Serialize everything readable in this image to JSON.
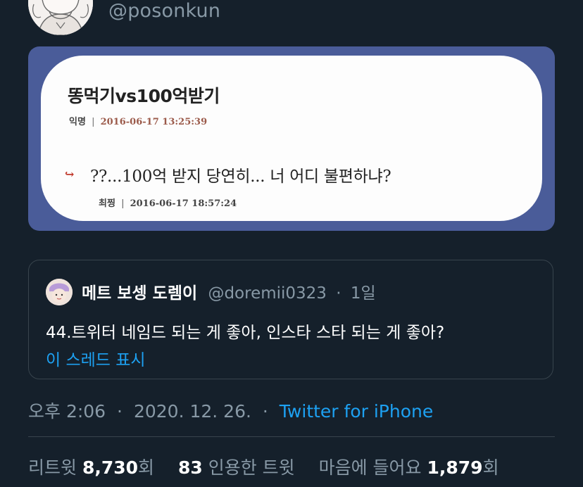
{
  "author": {
    "handle": "@posonkun"
  },
  "media": {
    "title": "똥먹기vs100억받기",
    "post_author": "익명",
    "post_sep": "|",
    "post_time": "2016-06-17 13:25:39",
    "reply_arrow": "↪",
    "reply_text": "??...100억 받지 당연히... 너 어디 불편하냐?",
    "reply_author": "최찡",
    "reply_sep": "|",
    "reply_time": "2016-06-17 18:57:24",
    "colors": {
      "frame": "#4a5c99",
      "card": "#fdfdfd"
    }
  },
  "quote": {
    "name": "메트 보셍 도렘이",
    "handle": "@doremii0323",
    "dot": "·",
    "age": "1일",
    "text": "44.트위터 네임드 되는 게 좋아, 인스타 스타 되는 게 좋아?",
    "thread_link": "이 스레드 표시"
  },
  "meta": {
    "time": "오후 2:06",
    "dot1": "·",
    "date": "2020. 12. 26.",
    "dot2": "·",
    "source": "Twitter for iPhone"
  },
  "stats": {
    "retweets_label": "리트윗",
    "retweets_value": "8,730",
    "retweets_suffix": "회",
    "quotes_value": "83",
    "quotes_label": "인용한 트윗",
    "likes_label": "마음에 들어요",
    "likes_value": "1,879",
    "likes_suffix": "회"
  },
  "colors": {
    "background": "#15202b",
    "accent": "#1da1f2",
    "secondary_text": "#8899a6",
    "border": "#38444d"
  }
}
